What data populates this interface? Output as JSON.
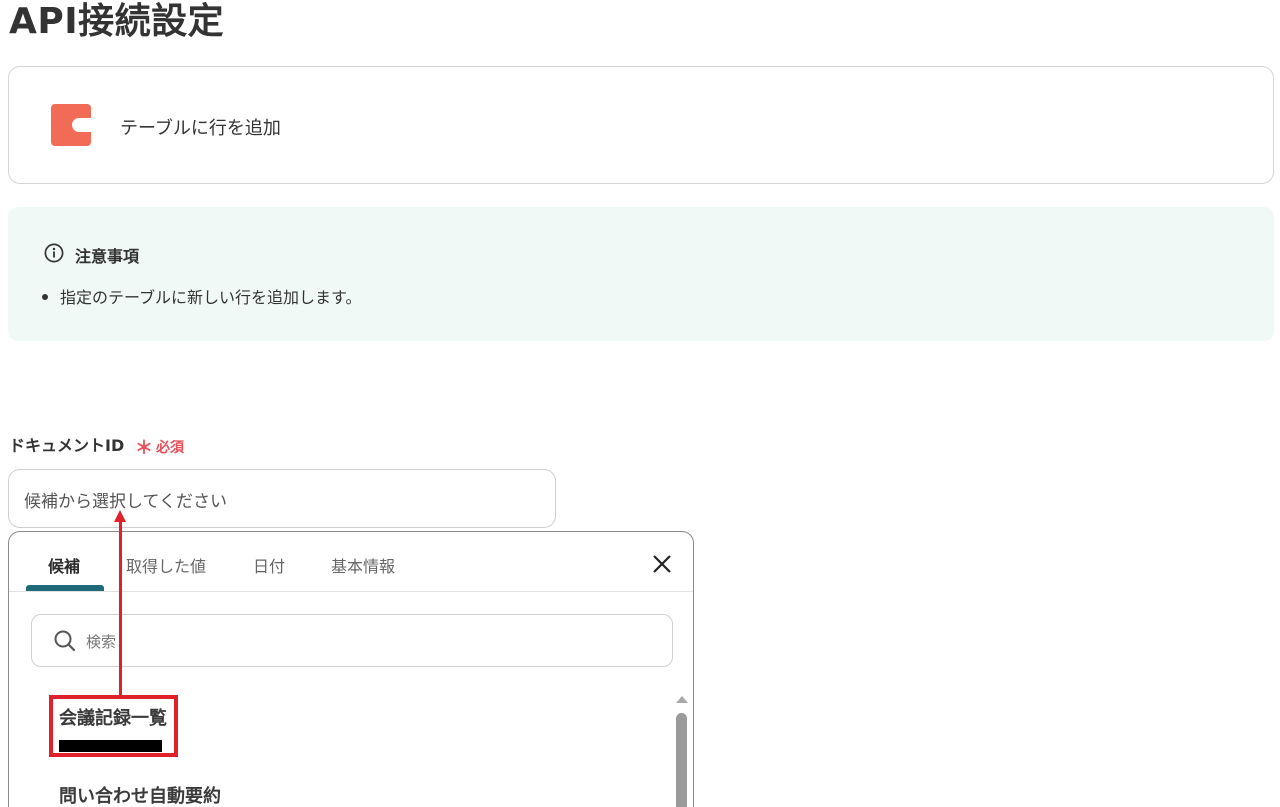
{
  "page": {
    "title": "API接続設定"
  },
  "action": {
    "label": "テーブルに行を追加",
    "logo_icon": "coda-logo-icon",
    "logo_color": "#f26b57"
  },
  "notice": {
    "icon": "info-circle-icon",
    "title": "注意事項",
    "items": [
      "指定のテーブルに新しい行を追加します。"
    ]
  },
  "field": {
    "label": "ドキュメントID",
    "required_mark": "＊",
    "required_text": "必須",
    "placeholder": "候補から選択してください",
    "required_color": "#e8505b"
  },
  "dropdown": {
    "tabs": [
      {
        "label": "候補",
        "active": true
      },
      {
        "label": "取得した値",
        "active": false
      },
      {
        "label": "日付",
        "active": false
      },
      {
        "label": "基本情報",
        "active": false
      }
    ],
    "tab_accent": "#1f6b7c",
    "close_icon": "close-icon",
    "search": {
      "placeholder": "検索",
      "value": "",
      "icon": "search-icon"
    },
    "options": [
      {
        "title": "会議記録一覧",
        "subtitle_redacted": true
      },
      {
        "title": "問い合わせ自動要約"
      }
    ]
  },
  "annotation": {
    "highlight_color": "#e0202a"
  }
}
